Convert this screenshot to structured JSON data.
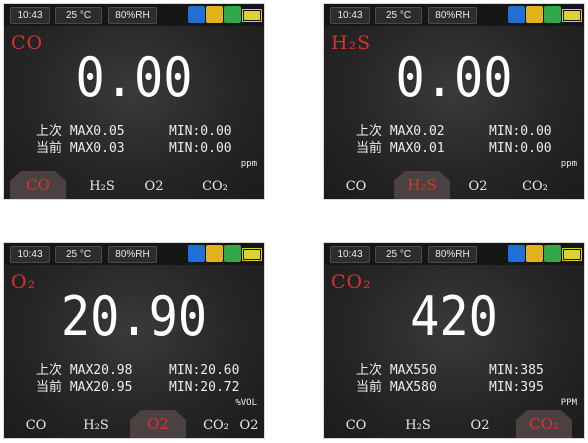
{
  "status": {
    "time": "10:43",
    "temp": "25 °C",
    "humidity": "80%RH",
    "icons": [
      "bluetooth-icon",
      "data-log-icon",
      "sync-icon",
      "battery-icon"
    ]
  },
  "screens": [
    {
      "gas": "CO",
      "reading": "0.00",
      "last_max": "上次 MAX0.05",
      "cur_max": "当前 MAX0.03",
      "last_min": "MIN:0.00",
      "cur_min": "MIN:0.00",
      "unit": "ppm",
      "tabs": [
        "CO",
        "H₂S",
        "O2",
        "CO₂"
      ],
      "active": 0
    },
    {
      "gas": "H₂S",
      "reading": "0.00",
      "last_max": "上次 MAX0.02",
      "cur_max": "当前 MAX0.01",
      "last_min": "MIN:0.00",
      "cur_min": "MIN:0.00",
      "unit": "ppm",
      "tabs": [
        "CO",
        "H₂S",
        "O2",
        "CO₂"
      ],
      "active": 1
    },
    {
      "gas": "O₂",
      "reading": "20.90",
      "last_max": "上次 MAX20.98",
      "cur_max": "当前 MAX20.95",
      "last_min": "MIN:20.60",
      "cur_min": "MIN:20.72",
      "unit": "%VOL",
      "tabs": [
        "CO",
        "H₂S",
        "O2",
        "CO₂",
        "O2"
      ],
      "active": 2
    },
    {
      "gas": "CO₂",
      "reading": "420",
      "last_max": "上次 MAX550",
      "cur_max": "当前 MAX580",
      "last_min": "MIN:385",
      "cur_min": "MIN:395",
      "unit": "PPM",
      "tabs": [
        "CO",
        "H₂S",
        "O2",
        "CO₂"
      ],
      "active": 3
    }
  ],
  "colors": {
    "accent": "#d83030",
    "bluetooth": "#1f6fd6",
    "log": "#e4b21d",
    "sync": "#2fa94a",
    "battery": "#d9d332"
  }
}
